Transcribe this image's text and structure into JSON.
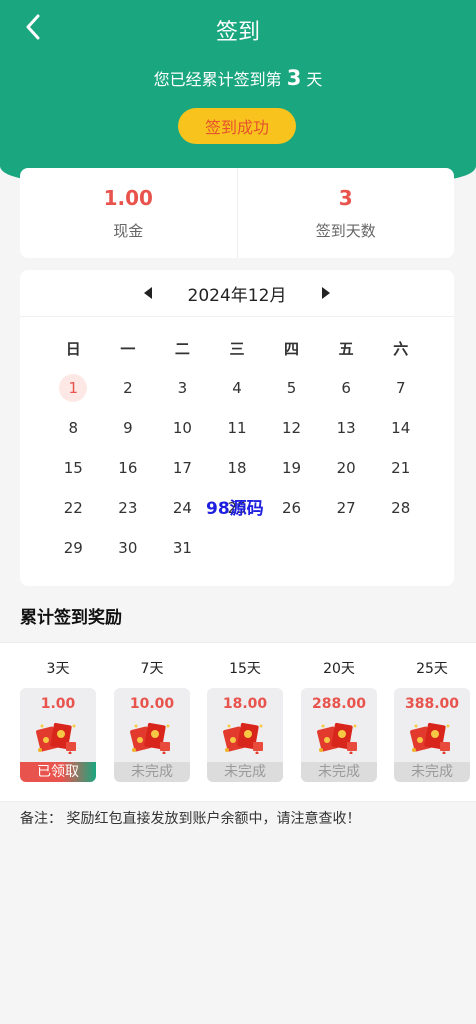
{
  "header": {
    "title": "签到",
    "summary_prefix": "您已经累计签到第",
    "summary_days": "3",
    "summary_suffix": "天",
    "checkin_button": "签到成功"
  },
  "stats": [
    {
      "value": "1.00",
      "label": "现金"
    },
    {
      "value": "3",
      "label": "签到天数"
    }
  ],
  "calendar": {
    "month_label": "2024年12月",
    "weekdays": [
      "日",
      "一",
      "二",
      "三",
      "四",
      "五",
      "六"
    ],
    "first_weekday_offset": 0,
    "days_in_month": 31,
    "checked_days": [
      1
    ]
  },
  "watermark": "98源码",
  "rewards": {
    "title": "累计签到奖励",
    "items": [
      {
        "day_label": "3天",
        "amount": "1.00",
        "status": "已领取",
        "claimed": true
      },
      {
        "day_label": "7天",
        "amount": "10.00",
        "status": "未完成",
        "claimed": false
      },
      {
        "day_label": "15天",
        "amount": "18.00",
        "status": "未完成",
        "claimed": false
      },
      {
        "day_label": "20天",
        "amount": "288.00",
        "status": "未完成",
        "claimed": false
      },
      {
        "day_label": "25天",
        "amount": "388.00",
        "status": "未完成",
        "claimed": false
      }
    ]
  },
  "note": "备注：  奖励红包直接发放到账户余额中，请注意查收！",
  "colors": {
    "primary": "#1aa67f",
    "accent": "#e8544d",
    "button": "#f8c31d"
  }
}
